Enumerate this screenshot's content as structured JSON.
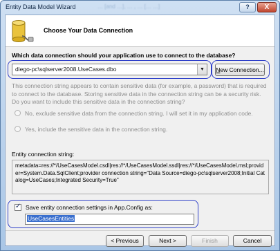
{
  "window": {
    "title": "Entity Data Model Wizard",
    "background_title_text": "… [and …], … , …   [… …]",
    "help_label": "?",
    "close_label": "X"
  },
  "header": {
    "heading": "Choose Your Data Connection",
    "icon": "database-plug-icon"
  },
  "connection": {
    "question": "Which data connection should your application use to connect to the database?",
    "selected": "diego-pc\\sqlserver2008.UseCases.dbo",
    "dropdown_icon": "chevron-down-icon",
    "new_connection_label": "New Connection..."
  },
  "sensitive": {
    "paragraph": "This connection string appears to contain sensitive data (for example, a password) that is required to connect to the database. Storing sensitive data in the connection string can be a security risk. Do you want to include this sensitive data in the connection string?",
    "option_no": "No, exclude sensitive data from the connection string. I will set it in my application code.",
    "option_yes": "Yes, include the sensitive data in the connection string."
  },
  "entity_connection": {
    "label": "Entity connection string:",
    "value": "metadata=res://*/UseCasesModel.csdl|res://*/UseCasesModel.ssdl|res://*/UseCasesModel.msl;provider=System.Data.SqlClient;provider connection string=\"Data Source=diego-pc\\sqlserver2008;Initial Catalog=UseCases;Integrated Security=True\""
  },
  "save_settings": {
    "label": "Save entity connection settings in App.Config as:",
    "checked": true,
    "value": "UseCasesEntities"
  },
  "footer": {
    "previous_label": "Previous",
    "next_label": "Next",
    "finish_label": "Finish",
    "cancel_label": "Cancel"
  },
  "colors": {
    "highlight_ring": "#2e3fc9",
    "selection": "#3a6fce"
  }
}
